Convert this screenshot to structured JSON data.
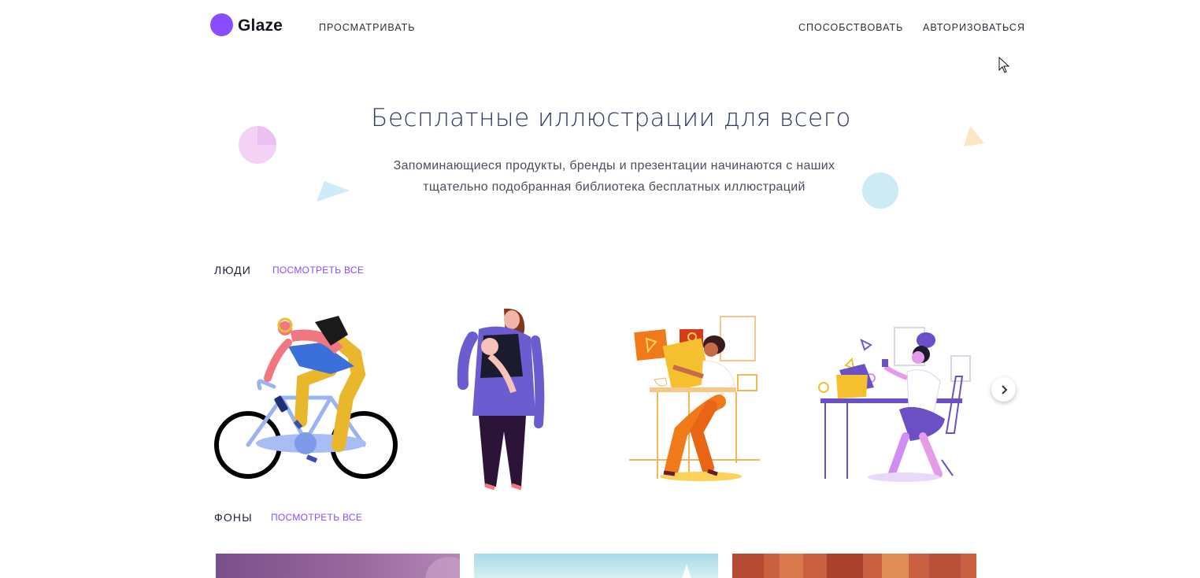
{
  "header": {
    "brand": "Glaze",
    "nav_browse": "ПРОСМАТРИВАТЬ",
    "nav_contribute": "СПОСОБСТВОВАТЬ",
    "nav_login": "АВТОРИЗОВАТЬСЯ",
    "brand_color": "#8a4cff"
  },
  "hero": {
    "title": "Бесплатные иллюстрации для всего",
    "subtitle_line1": "Запоминающиеся продукты, бренды и презентации начинаются с наших",
    "subtitle_line2": "тщательно подобранная библиотека бесплатных иллюстраций"
  },
  "sections": {
    "people": {
      "title": "ЛЮДИ",
      "see_all": "ПОСМОТРЕТЬ ВСЕ"
    },
    "backgrounds": {
      "title": "ФОНЫ",
      "see_all": "ПОСМОТРЕТЬ ВСЕ"
    }
  },
  "icons": {
    "carousel_next": "chevron-right-icon",
    "cursor": "mouse-pointer-icon"
  },
  "colors": {
    "accent": "#8a4cff",
    "title": "#2f3a63"
  }
}
